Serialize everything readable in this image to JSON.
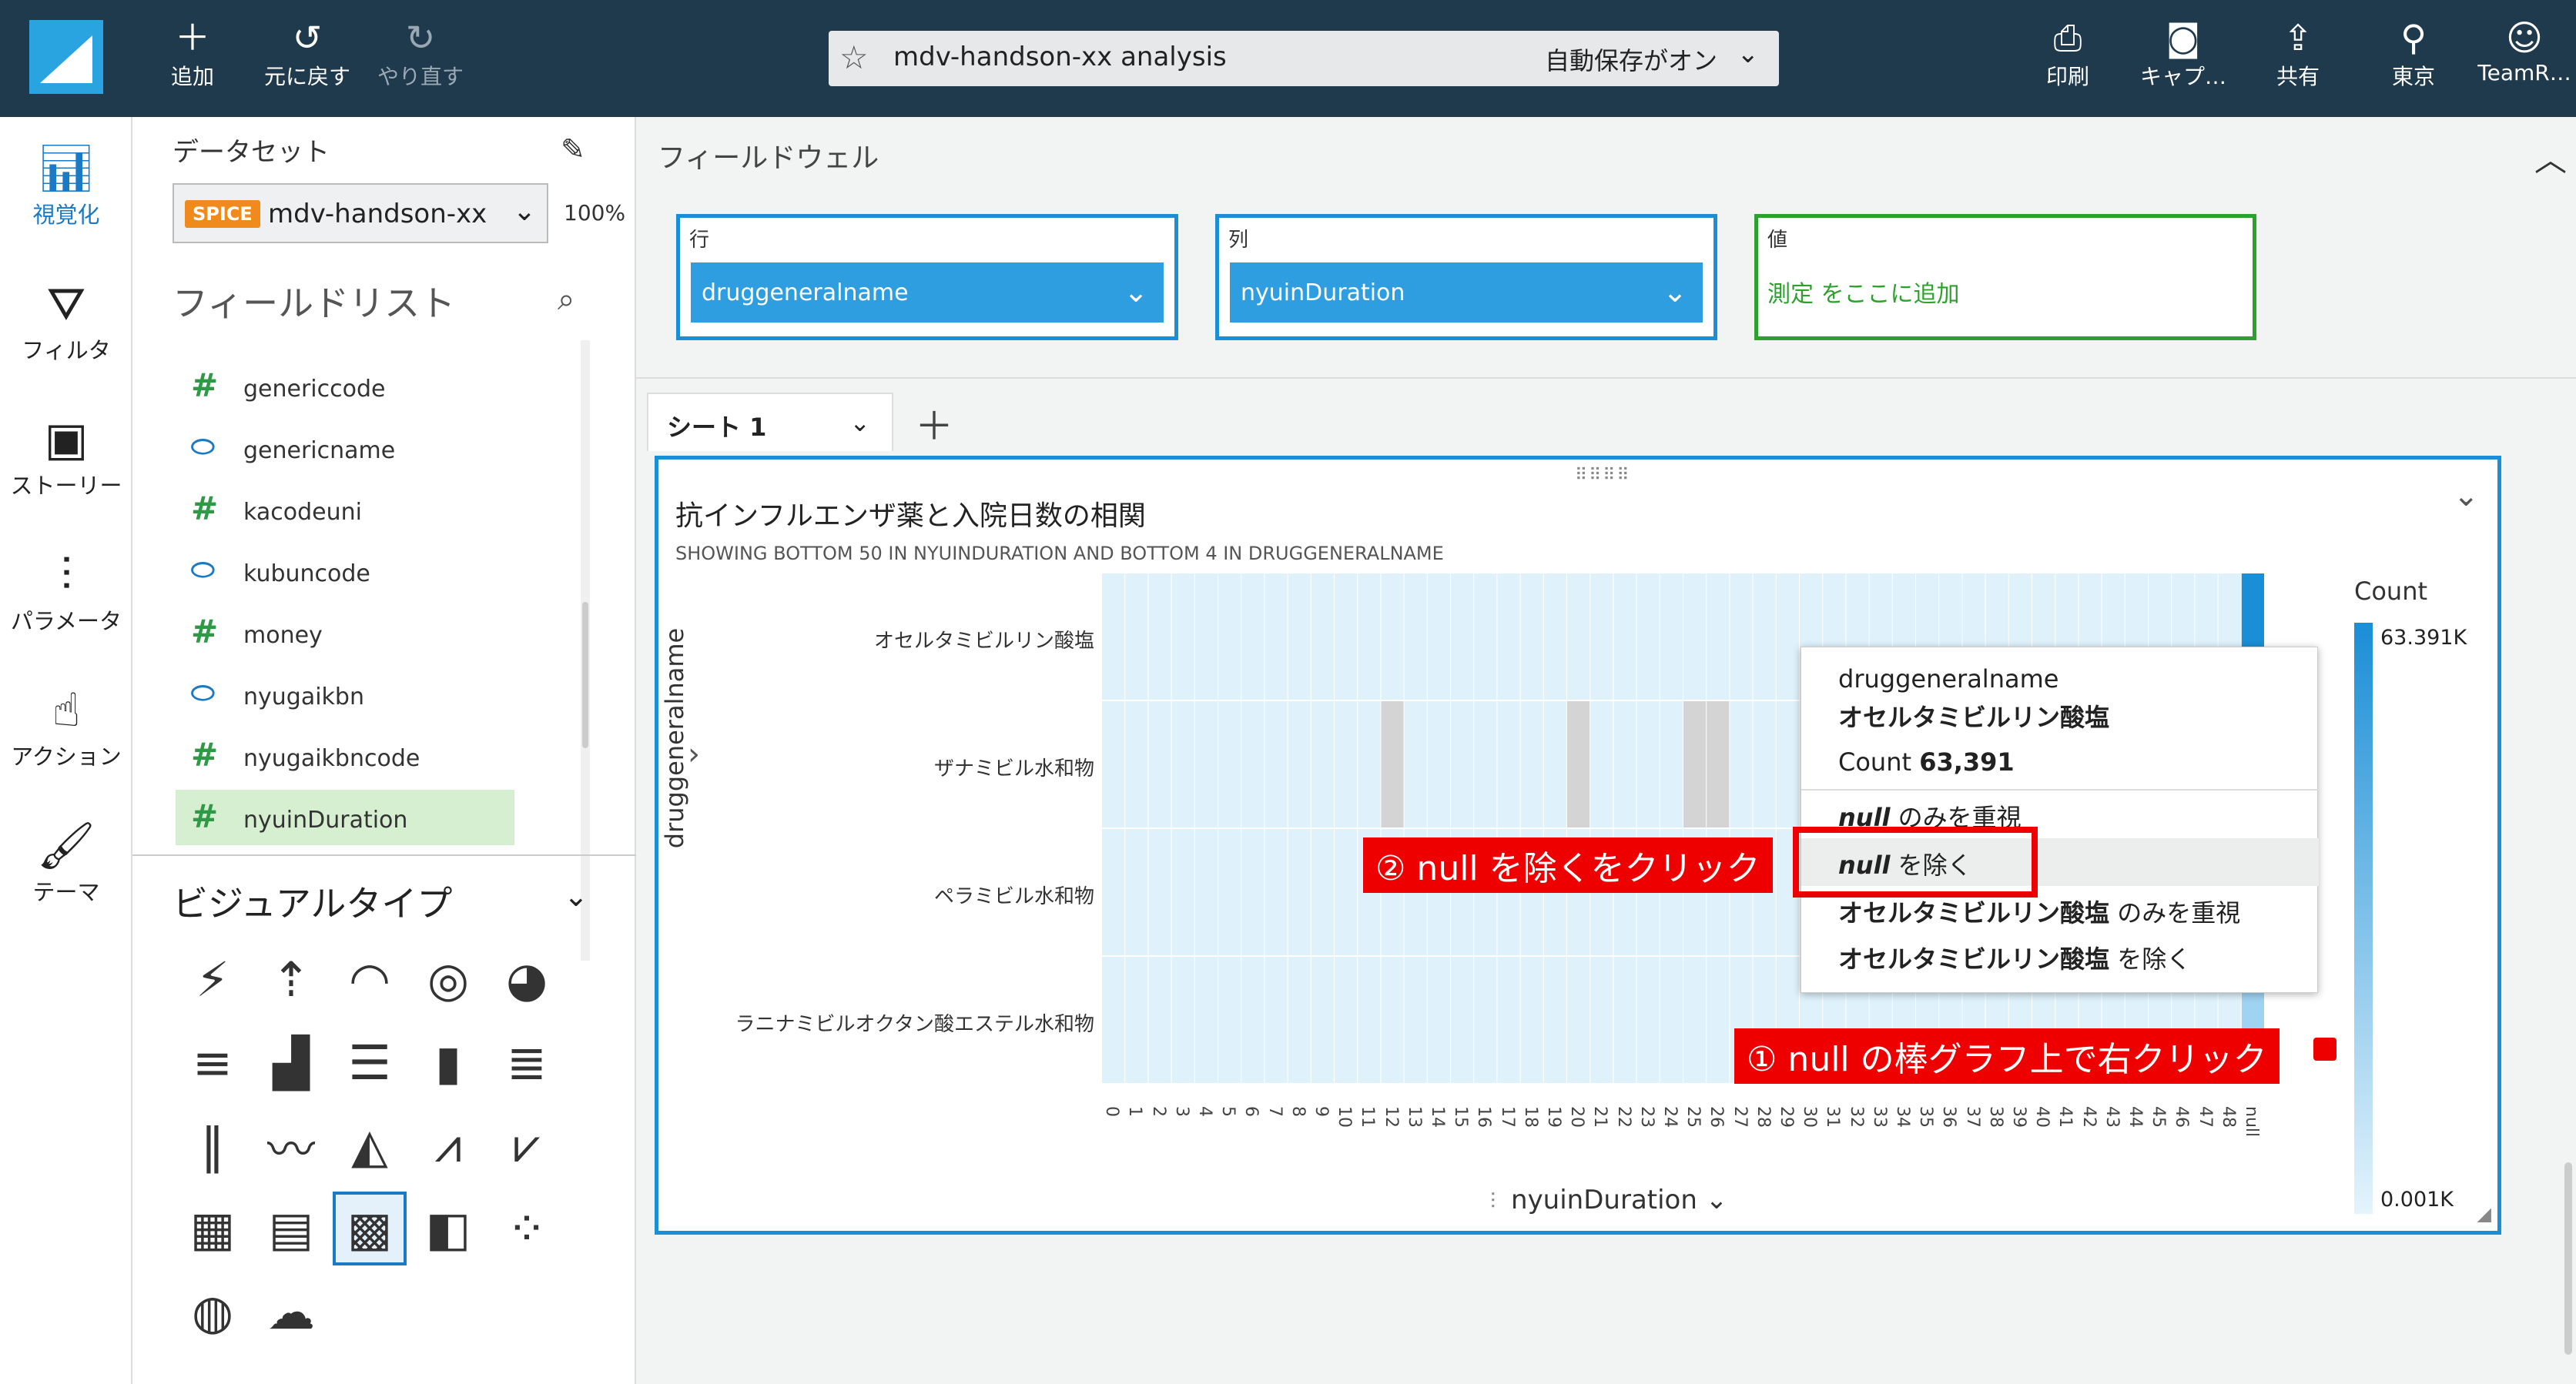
{
  "topbar": {
    "add": "追加",
    "undo": "元に戻す",
    "redo": "やり直す",
    "analysis_name": "mdv-handson-xx analysis",
    "autosave": "自動保存がオン",
    "print": "印刷",
    "capture": "キャプ…",
    "share": "共有",
    "region": "東京",
    "user": "TeamR…"
  },
  "leftnav": {
    "visualize": "視覚化",
    "filter": "フィルタ",
    "story": "ストーリー",
    "parameter": "パラメータ",
    "action": "アクション",
    "theme": "テーマ"
  },
  "dataset": {
    "label": "データセット",
    "badge": "SPICE",
    "name": "mdv-handson-xx",
    "percent": "100%"
  },
  "fieldlist": {
    "title": "フィールドリスト",
    "items": [
      {
        "name": "genericcode",
        "type": "measure"
      },
      {
        "name": "genericname",
        "type": "dimension"
      },
      {
        "name": "kacodeuni",
        "type": "measure"
      },
      {
        "name": "kubuncode",
        "type": "dimension"
      },
      {
        "name": "money",
        "type": "measure"
      },
      {
        "name": "nyugaikbn",
        "type": "dimension"
      },
      {
        "name": "nyugaikbncode",
        "type": "measure"
      },
      {
        "name": "nyuinDuration",
        "type": "measure"
      }
    ]
  },
  "visualtypes": {
    "title": "ビジュアルタイプ"
  },
  "fieldwell": {
    "title": "フィールドウェル",
    "row_label": "行",
    "row_value": "druggeneralname",
    "col_label": "列",
    "col_value": "nyuinDuration",
    "val_label": "値",
    "val_placeholder": "測定 をここに追加"
  },
  "sheet": {
    "tab": "シート 1"
  },
  "visual": {
    "title": "抗インフルエンザ薬と入院日数の相関",
    "subtitle": "SHOWING BOTTOM 50 IN NYUINDURATION AND BOTTOM 4 IN DRUGGENERALNAME",
    "x_field": "nyuinDuration",
    "y_field": "druggeneralname",
    "legend_title": "Count",
    "legend_max": "63.391K",
    "legend_min": "0.001K"
  },
  "chart_data": {
    "type": "heatmap",
    "rows": [
      "オセルタミビルリン酸塩",
      "ザナミビル水和物",
      "ペラミビル水和物",
      "ラニナミビルオクタン酸エステル水和物"
    ],
    "columns": [
      "0",
      "1",
      "2",
      "3",
      "4",
      "5",
      "6",
      "7",
      "8",
      "9",
      "10",
      "11",
      "12",
      "13",
      "14",
      "15",
      "16",
      "17",
      "18",
      "19",
      "20",
      "21",
      "22",
      "23",
      "24",
      "25",
      "26",
      "27",
      "28",
      "29",
      "30",
      "31",
      "32",
      "33",
      "34",
      "35",
      "36",
      "37",
      "38",
      "39",
      "40",
      "41",
      "42",
      "43",
      "44",
      "45",
      "46",
      "47",
      "48",
      "null"
    ],
    "gray_cells": [
      [
        1,
        12
      ],
      [
        1,
        20
      ],
      [
        1,
        25
      ],
      [
        1,
        26
      ]
    ],
    "highlight": {
      "row": 0,
      "column": "null",
      "count": 63391
    },
    "legend": {
      "min": 1,
      "max": 63391,
      "unit": "count"
    }
  },
  "popup": {
    "field": "druggeneralname",
    "value": "オセルタミビルリン酸塩",
    "count_label": "Count",
    "count_value": "63,391",
    "opt1_a": "null",
    "opt1_b": " のみを重視",
    "opt2_a": "null",
    "opt2_b": " を除く",
    "opt3_a": "オセルタミビルリン酸塩",
    "opt3_b": " のみを重視",
    "opt4_a": "オセルタミビルリン酸塩",
    "opt4_b": " を除く"
  },
  "annotations": {
    "step1": "① null の棒グラフ上で右クリック",
    "step2": "② null を除くをクリック"
  },
  "colors": {
    "topbar": "#1f3a4d",
    "accent": "#1a8ed6",
    "heat_light": "#dff2fc",
    "heat_dark": "#1a8ed6",
    "annotation": "#e00000"
  }
}
